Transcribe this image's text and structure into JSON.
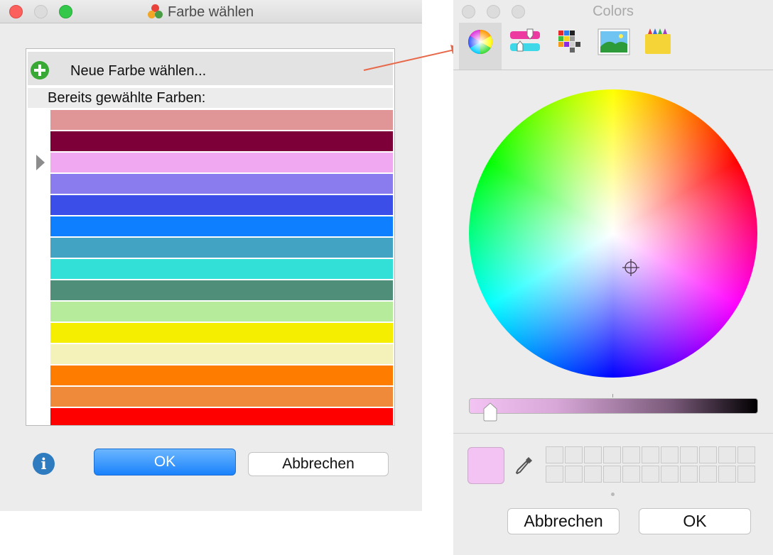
{
  "left_dialog": {
    "title": "Farbe wählen",
    "new_color_label": "Neue Farbe wählen...",
    "history_label": "Bereits gewählte Farben:",
    "swatches": [
      "#e09597",
      "#7d0038",
      "#f0a9f0",
      "#8a7bef",
      "#3b4ee8",
      "#0e7fff",
      "#42a4c2",
      "#33e0d8",
      "#4f8e78",
      "#b6eb9c",
      "#f6ee00",
      "#f4f2b8",
      "#fe7c00",
      "#ef8a3a",
      "#fe0000"
    ],
    "selected_swatch_index": 2,
    "ok_label": "OK",
    "cancel_label": "Abbrechen",
    "info_icon": "i"
  },
  "colors_panel": {
    "title": "Colors",
    "modes": [
      "color-wheel",
      "color-sliders",
      "color-palettes",
      "image-palettes",
      "crayons"
    ],
    "active_mode": "color-wheel",
    "current_color": "#f3c3f3",
    "cancel_label": "Abbrechen",
    "ok_label": "OK"
  },
  "theme": {
    "accent": "#1a82fb",
    "arrow": "#e8684a"
  }
}
